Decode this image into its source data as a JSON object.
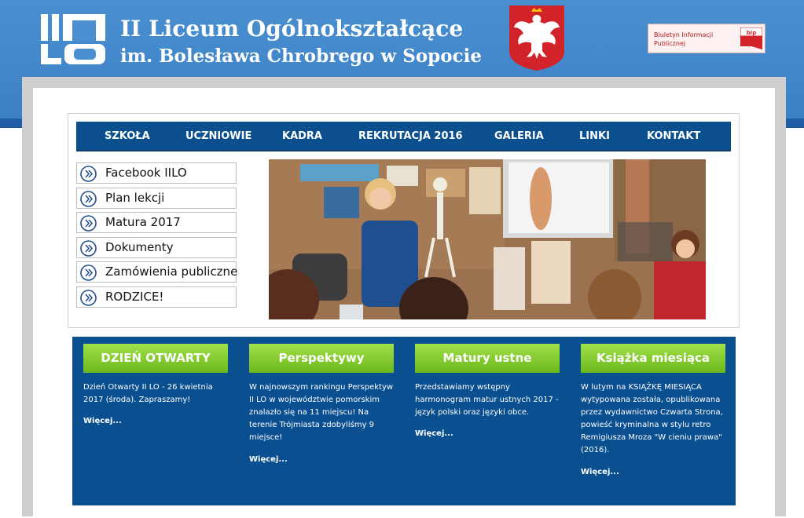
{
  "header": {
    "logo_text": "IILO",
    "title_line1": "II Liceum Ogólnokształcące",
    "title_line2": "im. Bolesława Chrobrego w Sopocie",
    "emblem_icon": "white-eagle-emblem-icon",
    "bip": {
      "text": "Biuletyn Informacji Publicznej",
      "flag_label": "bip"
    }
  },
  "colors": {
    "header_blue": "#4a90d0",
    "nav_blue": "#0c4f8e",
    "panel_blue": "#0a4f90",
    "green_button": "#7cc520",
    "bip_red": "#d2232a"
  },
  "nav": {
    "items": [
      "SZKOŁA",
      "UCZNIOWIE",
      "KADRA",
      "REKRUTACJA 2016",
      "GALERIA",
      "LINKI",
      "KONTAKT"
    ]
  },
  "sidebar": {
    "items": [
      "Facebook IILO",
      "Plan lekcji",
      "Matura 2017",
      "Dokumenty",
      "Zamówienia publiczne",
      "RODZICE!"
    ],
    "icon": "chevron-circle-icon"
  },
  "columns": [
    {
      "button": "DZIEŃ OTWARTY",
      "text": "Dzień Otwarty II LO - 26 kwietnia 2017 (środa). Zapraszamy!",
      "more": "Więcej..."
    },
    {
      "button": "Perspektywy",
      "text": "W najnowszym rankingu Perspektyw II LO w województwie pomorskim znalazło się na 11 miejscu! Na terenie Trójmiasta zdobyliśmy 9 miejsce!",
      "more": "Więcej..."
    },
    {
      "button": "Matury ustne",
      "text": "Przedstawiamy wstępny harmonogram matur ustnych 2017 - język polski oraz języki obce.",
      "more": "Więcej..."
    },
    {
      "button": "Książka miesiąca",
      "text": "W lutym na KSIĄŻKĘ MIESIĄCA wytypowana została, opublikowana przez wydawnictwo Czwarta Strona, powieść kryminalna w stylu retro Remigiusza Mroza \"W cieniu prawa\" (2016).",
      "more": "Więcej..."
    }
  ]
}
